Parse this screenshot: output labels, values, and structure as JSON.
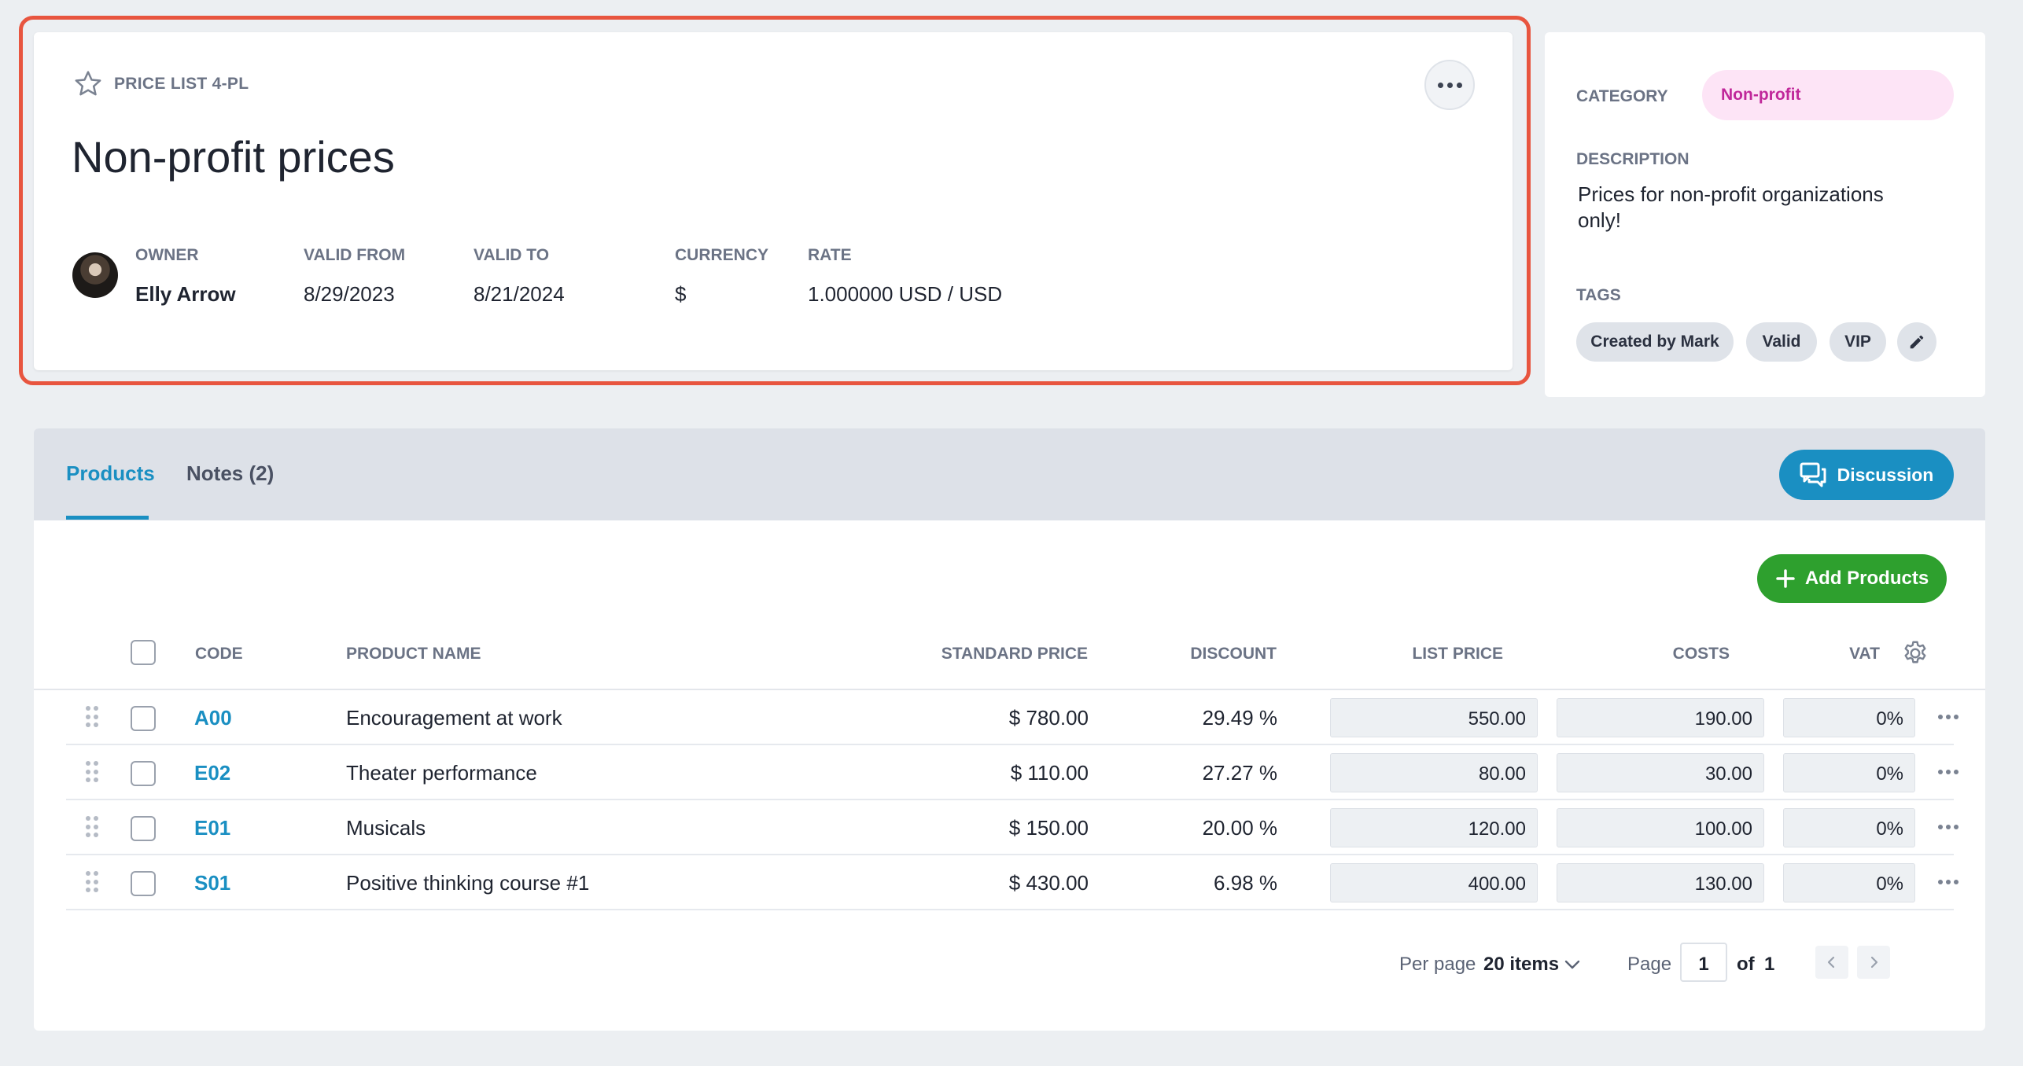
{
  "header": {
    "price_list_id": "PRICE LIST 4-PL",
    "title": "Non-profit prices",
    "owner_label": "OWNER",
    "owner_name": "Elly Arrow",
    "valid_from_label": "VALID FROM",
    "valid_from": "8/29/2023",
    "valid_to_label": "VALID TO",
    "valid_to": "8/21/2024",
    "currency_label": "CURRENCY",
    "currency": "$",
    "rate_label": "RATE",
    "rate": "1.000000 USD / USD"
  },
  "side": {
    "category_label": "CATEGORY",
    "category": "Non-profit",
    "description_label": "DESCRIPTION",
    "description": "Prices for non-profit organizations only!",
    "tags_label": "TAGS",
    "tags": [
      "Created by Mark",
      "Valid",
      "VIP"
    ]
  },
  "tabs": {
    "products": "Products",
    "notes": "Notes (2)",
    "discussion": "Discussion"
  },
  "toolbar": {
    "add_products": "Add Products"
  },
  "table": {
    "columns": {
      "code": "CODE",
      "product_name": "PRODUCT NAME",
      "standard_price": "STANDARD PRICE",
      "discount": "DISCOUNT",
      "list_price": "LIST PRICE",
      "costs": "COSTS",
      "vat": "VAT"
    },
    "rows": [
      {
        "code": "A00",
        "name": "Encouragement at work",
        "standard_price": "$ 780.00",
        "discount": "29.49 %",
        "list_price": "550.00",
        "costs": "190.00",
        "vat": "0%"
      },
      {
        "code": "E02",
        "name": "Theater performance",
        "standard_price": "$ 110.00",
        "discount": "27.27 %",
        "list_price": "80.00",
        "costs": "30.00",
        "vat": "0%"
      },
      {
        "code": "E01",
        "name": "Musicals",
        "standard_price": "$ 150.00",
        "discount": "20.00 %",
        "list_price": "120.00",
        "costs": "100.00",
        "vat": "0%"
      },
      {
        "code": "S01",
        "name": "Positive thinking course #1",
        "standard_price": "$ 430.00",
        "discount": "6.98 %",
        "list_price": "400.00",
        "costs": "130.00",
        "vat": "0%"
      }
    ]
  },
  "pagination": {
    "per_page_label": "Per page",
    "per_page_value": "20 items",
    "page_label": "Page",
    "current_page": "1",
    "of_label": "of",
    "total_pages": "1"
  },
  "colors": {
    "accent": "#1a8fc2",
    "success": "#2ea02e",
    "highlight": "#e8553f",
    "category_bg": "#fde4f6",
    "category_text": "#c0279a"
  }
}
